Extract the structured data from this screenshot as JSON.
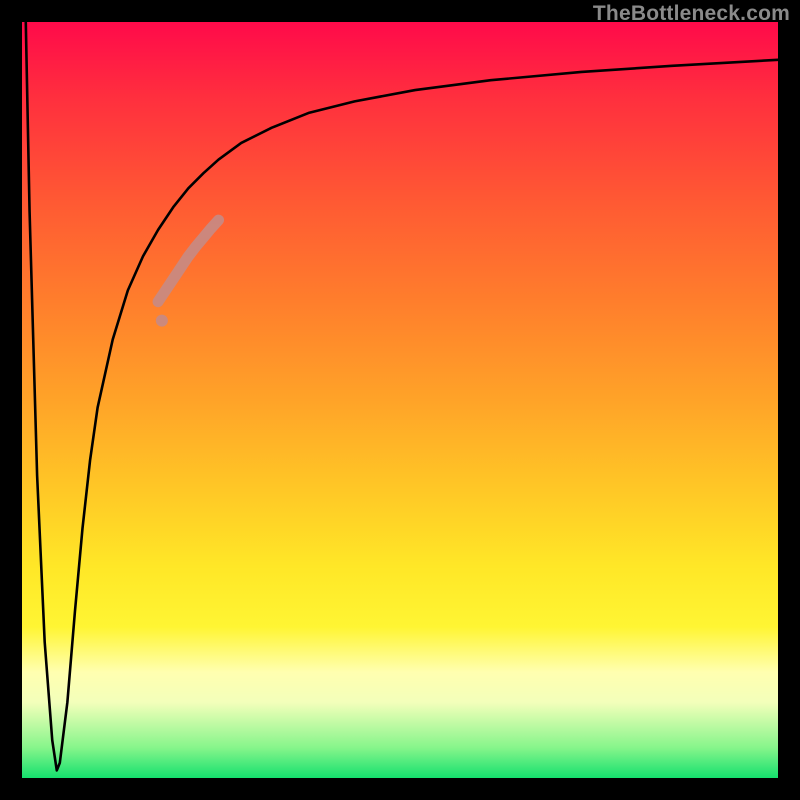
{
  "watermark": "TheBottleneck.com",
  "colors": {
    "frame": "#000000",
    "curve_main": "#000000",
    "curve_highlight": "#c88a83",
    "curve_highlight_dot": "#c88a83"
  },
  "chart_data": {
    "type": "line",
    "title": "",
    "xlabel": "",
    "ylabel": "",
    "xlim": [
      0,
      100
    ],
    "ylim": [
      0,
      100
    ],
    "grid": false,
    "legend": false,
    "series": [
      {
        "name": "bottleneck-curve",
        "x": [
          0.5,
          1.0,
          2.0,
          3.0,
          4.0,
          4.6,
          5.0,
          6.0,
          7.0,
          8.0,
          9.0,
          10.0,
          12.0,
          14.0,
          16.0,
          18.0,
          20.0,
          22.0,
          24.0,
          26.0,
          29.0,
          33.0,
          38.0,
          44.0,
          52.0,
          62.0,
          74.0,
          86.0,
          100.0
        ],
        "y": [
          100.0,
          75.0,
          40.0,
          18.0,
          5.0,
          1.0,
          2.0,
          10.0,
          22.0,
          33.0,
          42.0,
          49.0,
          58.0,
          64.5,
          69.0,
          72.5,
          75.5,
          78.0,
          80.0,
          81.8,
          84.0,
          86.0,
          88.0,
          89.5,
          91.0,
          92.3,
          93.4,
          94.2,
          95.0
        ]
      },
      {
        "name": "highlight-segment",
        "x": [
          18.0,
          19.0,
          20.0,
          21.0,
          22.0,
          23.0,
          24.0,
          25.0,
          26.0
        ],
        "y": [
          63.0,
          64.5,
          66.0,
          67.5,
          69.0,
          70.3,
          71.5,
          72.7,
          73.8
        ]
      },
      {
        "name": "highlight-dot",
        "x": [
          18.5
        ],
        "y": [
          60.5
        ]
      }
    ]
  }
}
